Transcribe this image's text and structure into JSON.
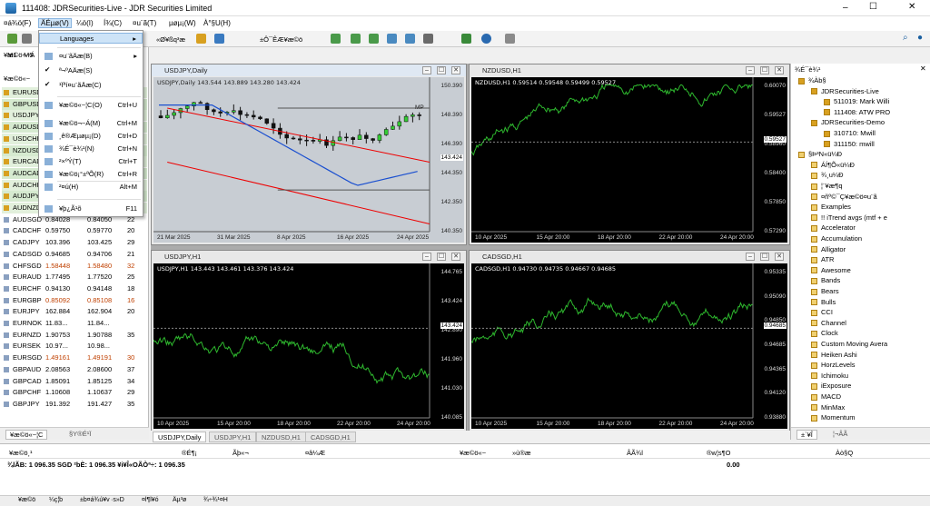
{
  "window": {
    "title": "111408: JDRSecurities-Live - JDR Securities Limited",
    "min": "–",
    "max": "☐",
    "close": "✕"
  },
  "menu": [
    "¤á¾ö(F)",
    "ÄÉµø(V)",
    "¼ö(I)",
    "Í¾(C)",
    "¤u¨ã(T)",
    "µøµ¡(W)",
    "À°§U(H)"
  ],
  "toolbar": {
    "neworder": "«Ø¥ß­q³æ",
    "algo": "±Ô¯ÊÆ¥æ©ö"
  },
  "market": {
    "title": "¥æ©ö¬~Á",
    "tabs": [
      "M1",
      "M5"
    ],
    "header": "¥æ©ö«~",
    "rows": [
      [
        "EURUSD",
        "",
        "",
        ""
      ],
      [
        "GBPUSD",
        "",
        "",
        ""
      ],
      [
        "USDJPY",
        "",
        "",
        ""
      ],
      [
        "AUDUSD",
        "",
        "",
        ""
      ],
      [
        "USDCHF",
        "",
        "",
        ""
      ],
      [
        "NZDUSD",
        "",
        "",
        ""
      ],
      [
        "EURCAD",
        "",
        "",
        ""
      ],
      [
        "AUDCAD",
        "",
        "",
        ""
      ],
      [
        "AUDCHF",
        "",
        "",
        ""
      ],
      [
        "AUDJPY",
        "",
        "",
        ""
      ],
      [
        "AUDNZD",
        "",
        "",
        ""
      ],
      [
        "AUDSGD",
        "0.84028",
        "0.84050",
        "22"
      ],
      [
        "CADCHF",
        "0.59750",
        "0.59770",
        "20"
      ],
      [
        "CADJPY",
        "103.396",
        "103.425",
        "29"
      ],
      [
        "CADSGD",
        "0.94685",
        "0.94706",
        "21"
      ],
      [
        "CHFSGD",
        "1.58448",
        "1.58480",
        "32"
      ],
      [
        "EURAUD",
        "1.77495",
        "1.77520",
        "25"
      ],
      [
        "EURCHF",
        "0.94130",
        "0.94148",
        "18"
      ],
      [
        "EURGBP",
        "0.85092",
        "0.85108",
        "16"
      ],
      [
        "EURJPY",
        "162.884",
        "162.904",
        "20"
      ],
      [
        "EURNOK",
        "11.83...",
        "11.84...",
        ""
      ],
      [
        "EURNZD",
        "1.90753",
        "1.90788",
        "35"
      ],
      [
        "EURSEK",
        "10.97...",
        "10.98...",
        ""
      ],
      [
        "EURSGD",
        "1.49161",
        "1.49191",
        "30"
      ],
      [
        "GBPAUD",
        "2.08563",
        "2.08600",
        "37"
      ],
      [
        "GBPCAD",
        "1.85091",
        "1.85125",
        "34"
      ],
      [
        "GBPCHF",
        "1.10608",
        "1.10637",
        "29"
      ],
      [
        "GBPJPY",
        "191.392",
        "191.427",
        "35"
      ]
    ],
    "bottomtabs": [
      "¥æ©ö«~¦C",
      "§Y®É¹Ï"
    ]
  },
  "dropdown": {
    "items": [
      {
        "label": "Languages",
        "shortcut": "▸",
        "hl": true
      },
      {
        "label": "¤u¨ãÄæ(B)",
        "shortcut": "▸"
      },
      {
        "label": "ª¬ºAÄæ(S)",
        "shortcut": "",
        "check": true
      },
      {
        "label": "¹Ïªí¤u¨ãÄæ(C)",
        "shortcut": "",
        "check": true
      },
      {
        "label": "¥æ©ö«~¦C(O)",
        "shortcut": "Ctrl+U"
      },
      {
        "label": "¥æ©ö¬~Á(M)",
        "shortcut": "Ctrl+M"
      },
      {
        "label": "¸ê®Æµøµ¡(D)",
        "shortcut": "Ctrl+D"
      },
      {
        "label": "¾É¯è¾¹(N)",
        "shortcut": "Ctrl+N"
      },
      {
        "label": "²×ºÝ(T)",
        "shortcut": "Ctrl+T"
      },
      {
        "label": "¥æ©ö¡°±ªÕ(R)",
        "shortcut": "Ctrl+R"
      },
      {
        "label": "²¤ú(H)",
        "shortcut": "Alt+M"
      },
      {
        "label": "¥þ¿Ã¹õ",
        "shortcut": "F11"
      }
    ]
  },
  "charts": [
    {
      "tab": "USDJPY,Daily",
      "label": "USDJPY,Daily  143.544 143.889 143.280 143.424",
      "y": [
        "150.390",
        "148.390",
        "146.390",
        "144.350",
        "142.350",
        "140.350"
      ],
      "x": [
        "21 Mar 2025",
        "31 Mar 2025",
        "8 Apr 2025",
        "16 Apr 2025",
        "24 Apr 2025"
      ],
      "last": "143.424",
      "mp": "MP"
    },
    {
      "tab": "NZDUSD,H1",
      "label": "NZDUSD,H1  0.59514 0.59548 0.59499 0.59527",
      "y": [
        "0.60070",
        "0.59527",
        "0.58960",
        "0.58400",
        "0.57850",
        "0.57290"
      ],
      "x": [
        "10 Apr 2025",
        "15 Apr 20:00",
        "18 Apr 20:00",
        "22 Apr 20:00",
        "24 Apr 20:00"
      ],
      "last": "0.59527"
    },
    {
      "tab": "USDJPY,H1",
      "label": "USDJPY,H1  143.443 143.461 143.376 143.424",
      "y": [
        "144.765",
        "143.424",
        "142.890",
        "141.960",
        "141.030",
        "140.085"
      ],
      "x": [
        "10 Apr 2025",
        "15 Apr 20:00",
        "18 Apr 20:00",
        "22 Apr 20:00",
        "24 Apr 20:00"
      ],
      "last": "143.424"
    },
    {
      "tab": "CADSGD,H1",
      "label": "CADSGD,H1  0.94730 0.94735 0.94667 0.94685",
      "y": [
        "0.95335",
        "0.95090",
        "0.94850",
        "0.94685",
        "0.94365",
        "0.94120",
        "0.93880"
      ],
      "x": [
        "10 Apr 2025",
        "15 Apr 20:00",
        "18 Apr 20:00",
        "22 Apr 20:00",
        "24 Apr 20:00"
      ],
      "last": "0.94685"
    }
  ],
  "navigator": {
    "title": "¾É¯è¾¹",
    "items": [
      {
        "t": "¾Àb§",
        "l": 0
      },
      {
        "t": "JDRSecurities-Live",
        "l": 1
      },
      {
        "t": "511019: Mark Willi",
        "l": 2
      },
      {
        "t": "111408: ATW PRO",
        "l": 2
      },
      {
        "t": "JDRSecurities-Demo",
        "l": 1
      },
      {
        "t": "310710: Mwill",
        "l": 2
      },
      {
        "t": "311150: mwill",
        "l": 2
      },
      {
        "t": "§Þ³N«ü¼Ð",
        "l": 0
      },
      {
        "t": "ÁÍ¶Õ«ü¼Ð",
        "l": 1
      },
      {
        "t": "¾¸u¼Ð",
        "l": 1
      },
      {
        "t": "¦¨¥æ¶q",
        "l": 1
      },
      {
        "t": "¤ñº©¯Ç¥æ©ö¤u¨ã",
        "l": 1
      },
      {
        "t": "Examples",
        "l": 1
      },
      {
        "t": "!! iTrend avgs  (mtf + e",
        "l": 1
      },
      {
        "t": "Accelerator",
        "l": 1
      },
      {
        "t": "Accumulation",
        "l": 1
      },
      {
        "t": "Alligator",
        "l": 1
      },
      {
        "t": "ATR",
        "l": 1
      },
      {
        "t": "Awesome",
        "l": 1
      },
      {
        "t": "Bands",
        "l": 1
      },
      {
        "t": "Bears",
        "l": 1
      },
      {
        "t": "Bulls",
        "l": 1
      },
      {
        "t": "CCI",
        "l": 1
      },
      {
        "t": "Channel",
        "l": 1
      },
      {
        "t": "Clock",
        "l": 1
      },
      {
        "t": "Custom Moving Avera",
        "l": 1
      },
      {
        "t": "Heiken Ashi",
        "l": 1
      },
      {
        "t": "HorzLevels",
        "l": 1
      },
      {
        "t": "Ichimoku",
        "l": 1
      },
      {
        "t": "iExposure",
        "l": 1
      },
      {
        "t": "MACD",
        "l": 1
      },
      {
        "t": "MinMax",
        "l": 1
      },
      {
        "t": "Momentum",
        "l": 1
      }
    ],
    "tabs": [
      "±`¥Î",
      "¦¬ÂÃ"
    ]
  },
  "terminal": {
    "cols": [
      "¥æ©ö¸¹",
      "®É¶¡",
      "Ãþ«¬",
      "¤â¼Æ",
      "¥æ©ö«~",
      "»ù®æ",
      "ÂÃ¾l",
      "®w¦s¶O",
      "Àò§Q"
    ],
    "balance": "¾lÃB: 1 096.35 SGD  ²b­È: 1 096.35  ¥i¥Î«OÃÒª÷: 1 096.35",
    "balance_val": "0.00",
    "tabs": [
      "¥æ©ö",
      "¼ç¦b",
      "±b¤á¾ú¥v",
      "·s»D",
      "¤l¶l¥ó",
      "Äµ³ø",
      "¾÷¾¹¤H"
    ]
  }
}
